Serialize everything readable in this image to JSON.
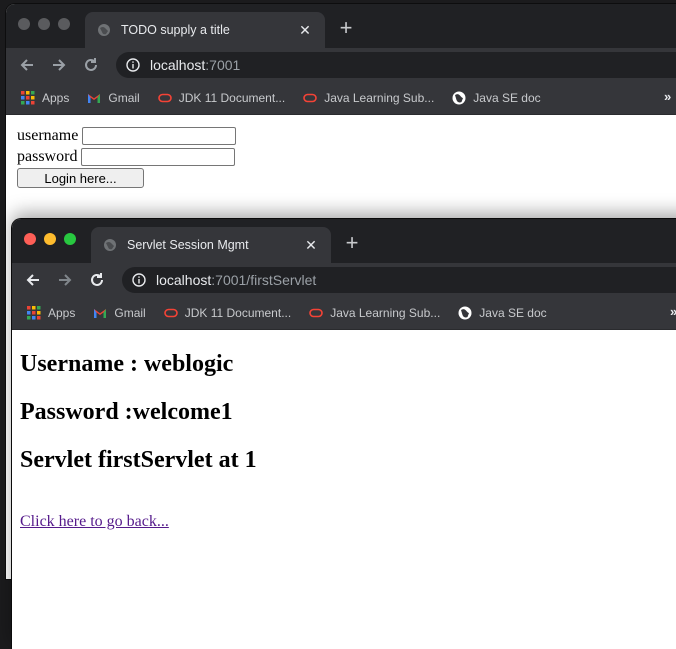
{
  "background_window": {
    "tab": {
      "title": "TODO supply a title"
    },
    "address": {
      "host": "localhost",
      "rest": ":7001"
    },
    "bookmarks": [
      {
        "label": "Apps",
        "icon": "apps-grid-icon"
      },
      {
        "label": "Gmail",
        "icon": "gmail-icon"
      },
      {
        "label": "JDK 11 Document...",
        "icon": "oracle-icon"
      },
      {
        "label": "Java Learning Sub...",
        "icon": "oracle-icon"
      },
      {
        "label": "Java SE doc",
        "icon": "globe-icon"
      }
    ],
    "bookmarks_more": "»",
    "form": {
      "username_label": "username",
      "username_value": "",
      "password_label": "password",
      "password_value": "",
      "submit_label": "Login here..."
    }
  },
  "foreground_window": {
    "tab": {
      "title": "Servlet Session Mgmt"
    },
    "address": {
      "host": "localhost",
      "rest": ":7001/firstServlet"
    },
    "bookmarks": [
      {
        "label": "Apps",
        "icon": "apps-grid-icon"
      },
      {
        "label": "Gmail",
        "icon": "gmail-icon"
      },
      {
        "label": "JDK 11 Document...",
        "icon": "oracle-icon"
      },
      {
        "label": "Java Learning Sub...",
        "icon": "oracle-icon"
      },
      {
        "label": "Java SE doc",
        "icon": "globe-icon"
      }
    ],
    "bookmarks_more": "»",
    "content": {
      "username_line": "Username : weblogic",
      "password_line": "Password :welcome1",
      "servlet_line": "Servlet firstServlet at 1",
      "back_link": "Click here to go back..."
    }
  },
  "colors": {
    "tabstrip": "#202124",
    "toolbar": "#35363a",
    "omnibox": "#202124",
    "link_visited": "#551a8b",
    "traffic_red": "#fe5f57",
    "traffic_yellow": "#febc2e",
    "traffic_green": "#28c840"
  }
}
